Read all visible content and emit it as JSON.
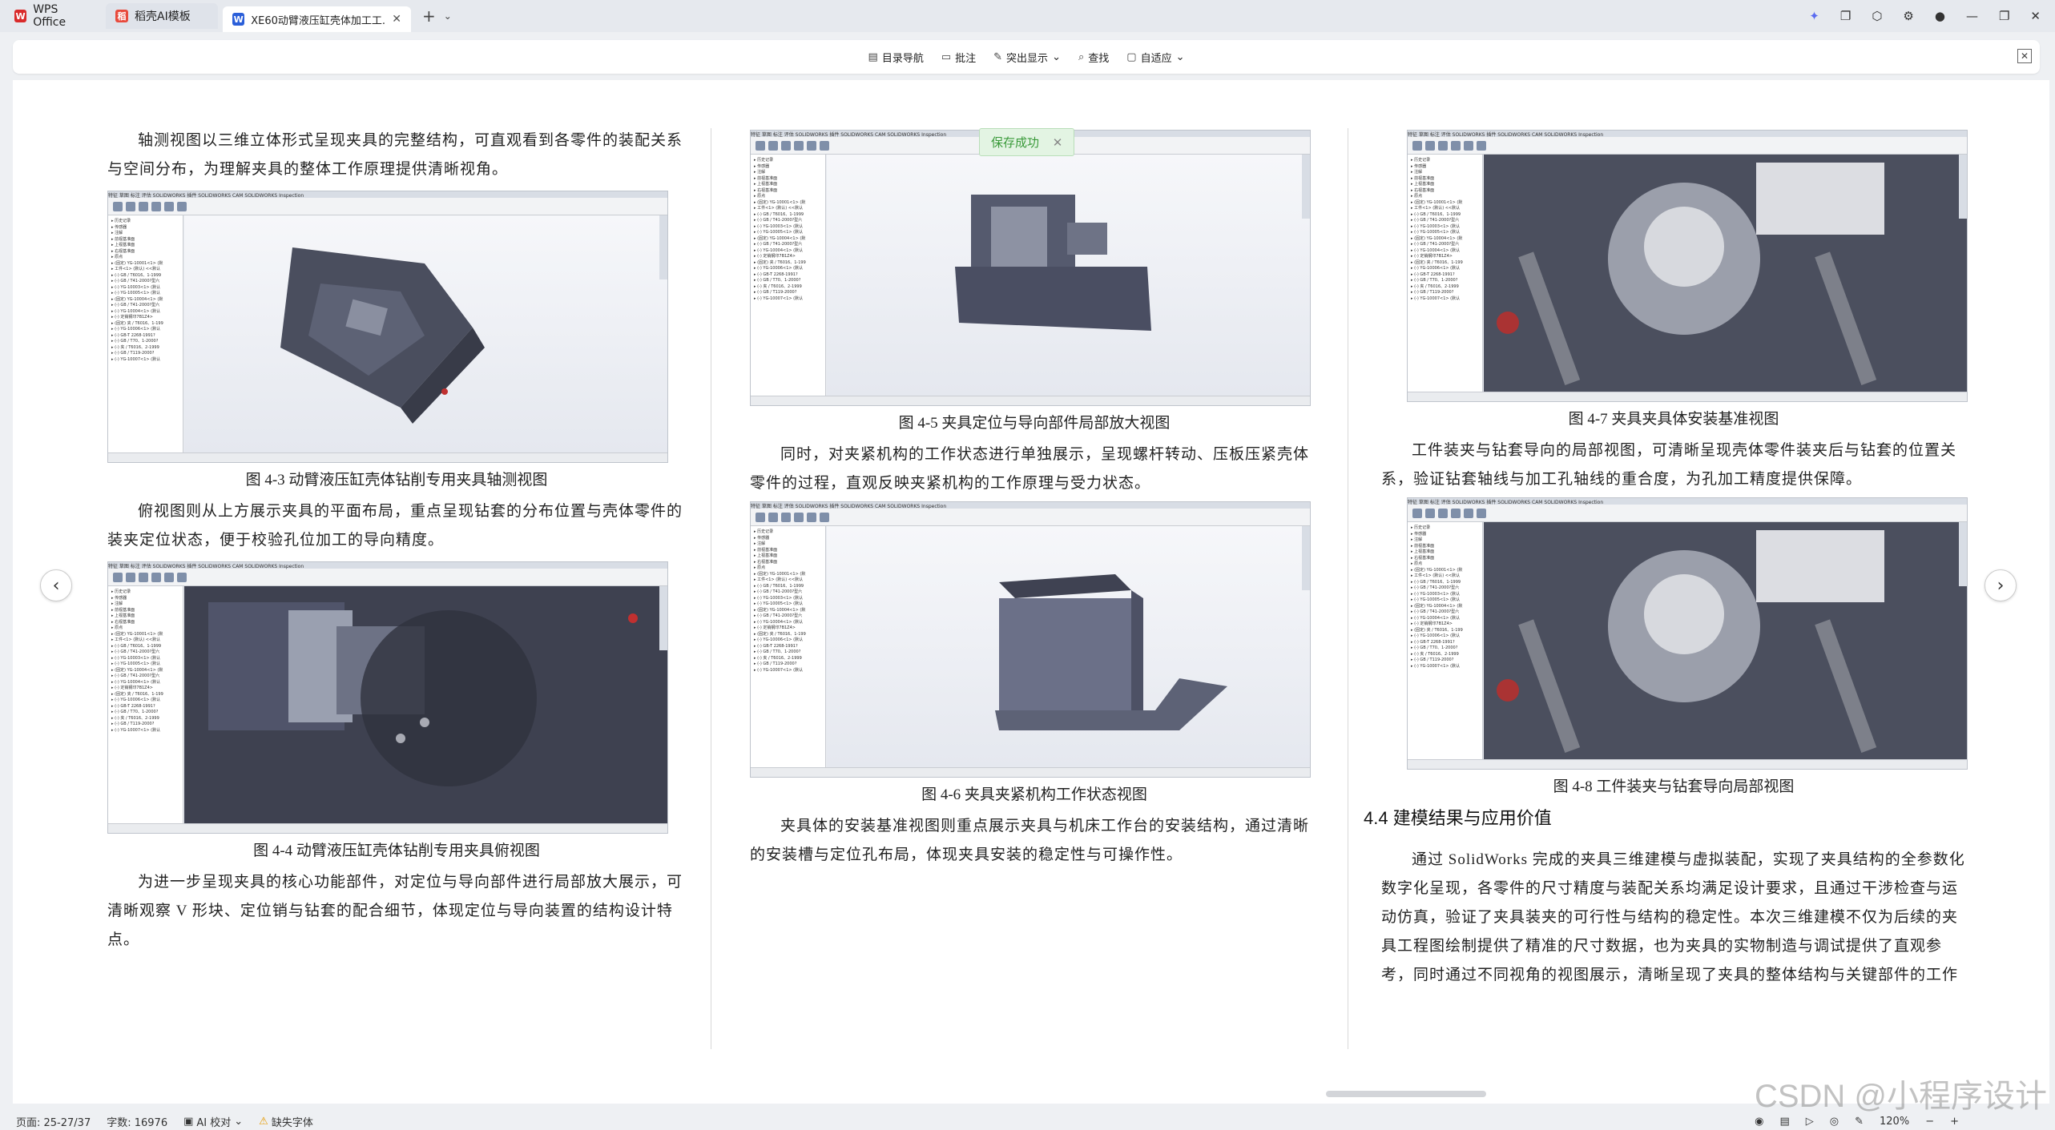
{
  "tabs": [
    {
      "label": "WPS Office",
      "icon": "wps-logo-icon",
      "color": "#d92b2b"
    },
    {
      "label": "稻壳AI模板",
      "icon": "docer-logo-icon",
      "color": "#e84a3c"
    },
    {
      "label": "XE60动臂液压缸壳体加工工...",
      "icon": "word-doc-icon",
      "color": "#2b5fd9"
    }
  ],
  "toolbar": {
    "toc": "目录导航",
    "annotate": "批注",
    "highlight": "突出显示",
    "find": "查找",
    "fit": "自适应"
  },
  "toast": "保存成功",
  "col1": {
    "p1": "轴测视图以三维立体形式呈现夹具的完整结构，可直观看到各零件的装配关系与空间分布，为理解夹具的整体工作原理提供清晰视角。",
    "cap1": "图 4-3 动臂液压缸壳体钻削专用夹具轴测视图",
    "p2": "俯视图则从上方展示夹具的平面布局，重点呈现钻套的分布位置与壳体零件的装夹定位状态，便于校验孔位加工的导向精度。",
    "cap2": "图 4-4 动臂液压缸壳体钻削专用夹具俯视图",
    "p3": "为进一步呈现夹具的核心功能部件，对定位与导向部件进行局部放大展示，可清晰观察 V 形块、定位销与钻套的配合细节，体现定位与导向装置的结构设计特点。"
  },
  "col2": {
    "cap1": "图 4-5 夹具定位与导向部件局部放大视图",
    "p1": "同时，对夹紧机构的工作状态进行单独展示，呈现螺杆转动、压板压紧壳体零件的过程，直观反映夹紧机构的工作原理与受力状态。",
    "cap2": "图 4-6 夹具夹紧机构工作状态视图",
    "p2": "夹具体的安装基准视图则重点展示夹具与机床工作台的安装结构，通过清晰的安装槽与定位孔布局，体现夹具安装的稳定性与可操作性。"
  },
  "col3": {
    "cap1": "图 4-7 夹具夹具体安装基准视图",
    "p1": "工件装夹与钻套导向的局部视图，可清晰呈现壳体零件装夹后与钻套的位置关系，验证钻套轴线与加工孔轴线的重合度，为孔加工精度提供保障。",
    "cap2": "图 4-8 工件装夹与钻套导向局部视图",
    "heading": "4.4 建模结果与应用价值",
    "p2": "通过 SolidWorks 完成的夹具三维建模与虚拟装配，实现了夹具结构的全参数化数字化呈现，各零件的尺寸精度与装配关系均满足设计要求，且通过干涉检查与运动仿真，验证了夹具装夹的可行性与结构的稳定性。本次三维建模不仅为后续的夹具工程图绘制提供了精准的尺寸数据，也为夹具的实物制造与调试提供了直观参考，同时通过不同视角的视图展示，清晰呈现了夹具的整体结构与关键部件的工作状态，为加工"
  },
  "cad_tree": [
    "历史记录",
    "传感器",
    "注解",
    "前视基准面",
    "上视基准面",
    "右视基准面",
    "原点",
    "(固定) YG-10001<1> (默",
    "工件<1> (默认) <<默认",
    "(-) GB / T6016、1-1999",
    "(-) GB / T41-2000?型六",
    "(-) YG-10003<1> (默认",
    "(-) YG-10005<1> (默认",
    "(固定) YG-10004<1> (默",
    "(-) GB / T41-2000?型六",
    "(-) YG-10004<1> (默认",
    "(-) 定销钢印7B1Z4>",
    "(固定) 夹 / T6016、1-199",
    "(-) YG-10006<1> (默认",
    "(-) GB-T 2268-1991?",
    "(-) GB / T70、1-2000?",
    "(-) 夹 / T6016、2-1999",
    "(-) GB / T119-2000?",
    "(-) YG-10007<1> (默认"
  ],
  "cad_tabs": "特征 草图 标注 评估 SOLIDWORKS 插件 SOLIDWORKS CAM SOLIDWORKS Inspection",
  "statusbar": {
    "page": "页面: 25-27/37",
    "words": "字数: 16976",
    "ai": "AI 校对",
    "font": "缺失字体",
    "zoom": "120%"
  },
  "watermark": "CSDN @小程序设计"
}
